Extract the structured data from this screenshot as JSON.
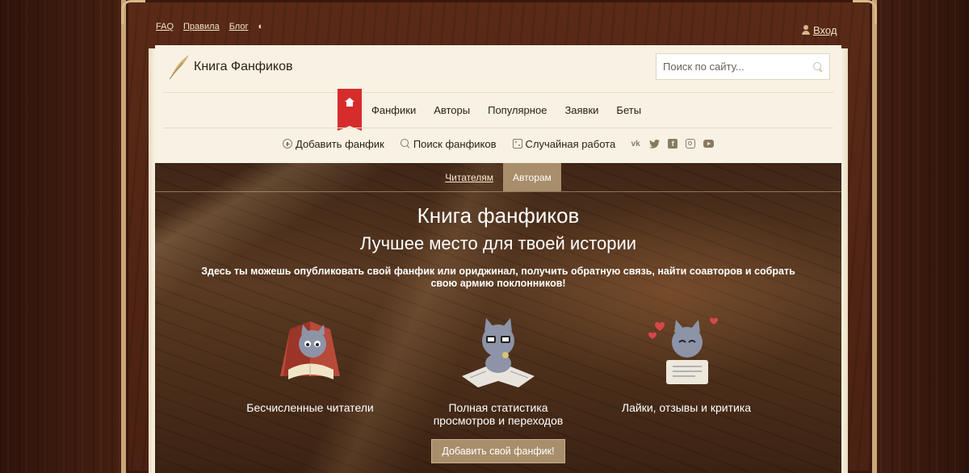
{
  "toplinks": {
    "faq": "FAQ",
    "rules": "Правила",
    "blog": "Блог"
  },
  "login": {
    "label": "Вход"
  },
  "brand": {
    "name": "Книга Фанфиков"
  },
  "search": {
    "placeholder": "Поиск по сайту..."
  },
  "mainnav": {
    "items": [
      "Фанфики",
      "Авторы",
      "Популярное",
      "Заявки",
      "Беты"
    ]
  },
  "subnav": {
    "add": "Добавить фанфик",
    "search": "Поиск фанфиков",
    "random": "Случайная работа",
    "social": [
      "vk-icon",
      "twitter-icon",
      "facebook-icon",
      "instagram-icon",
      "youtube-icon"
    ]
  },
  "hero": {
    "tabs": [
      "Читателям",
      "Авторам"
    ],
    "active_tab": "Авторам",
    "title": "Книга фанфиков",
    "subtitle": "Лучшее место для твоей истории",
    "description": "Здесь ты можешь опубликовать свой фанфик или ориджинал, получить обратную связь, найти соавторов и собрать свою армию поклонников!",
    "features": [
      {
        "caption": "Бесчисленные читатели",
        "icon": "cat-reading-icon"
      },
      {
        "caption": "Полная статистика просмотров и переходов",
        "icon": "cat-with-glasses-icon"
      },
      {
        "caption": "Лайки, отзывы и критика",
        "icon": "cat-with-hearts-icon"
      }
    ],
    "cta": "Добавить свой фанфик!"
  },
  "colors": {
    "accent_red": "#d62c2c",
    "tan": "#a88e6a",
    "paper": "#f8f2e4",
    "wood": "#4a2112"
  }
}
